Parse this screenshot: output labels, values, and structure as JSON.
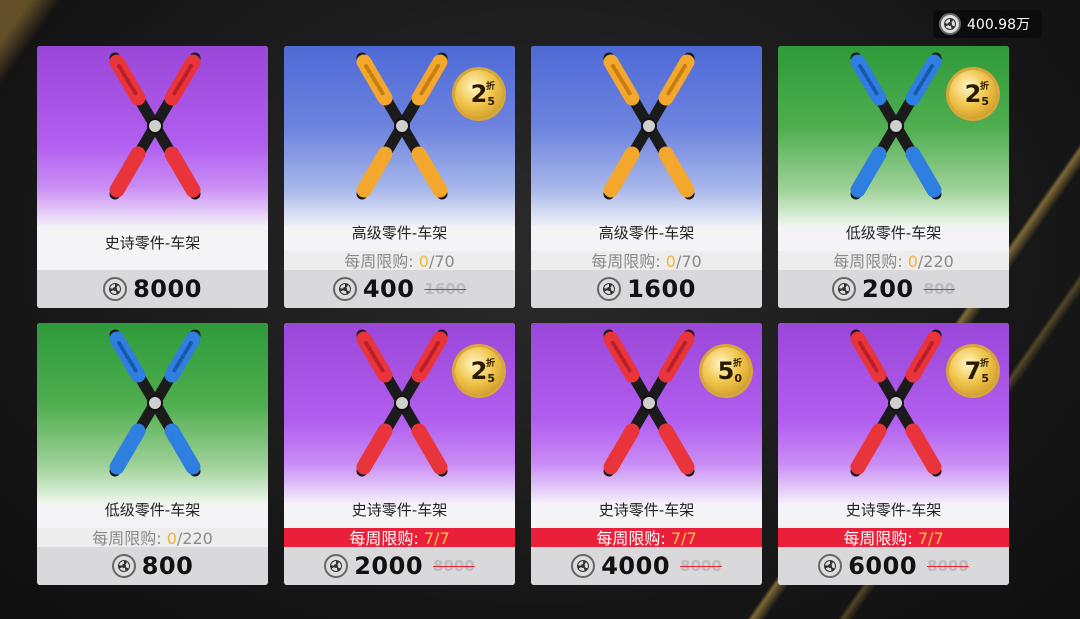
{
  "currency": {
    "icon": "coin-icon",
    "amount": "400.98万"
  },
  "colors": {
    "purple": "#b25ff0",
    "blue": "#6d83de",
    "green": "#4fae4f",
    "red_limit": "#ea1f3a",
    "gold": "#f0c44a"
  },
  "cards": [
    {
      "name": "史诗零件-车架",
      "bg": "purple",
      "grip": "red",
      "limit": null,
      "price": "8000",
      "old_price": null,
      "discount": null
    },
    {
      "name": "高级零件-车架",
      "bg": "blue",
      "grip": "orange",
      "limit": {
        "label": "每周限购:",
        "used": "0",
        "total": "/70",
        "hot": false
      },
      "price": "400",
      "old_price": "1600",
      "discount": {
        "big": "2",
        "small": "折",
        "dec": "5"
      }
    },
    {
      "name": "高级零件-车架",
      "bg": "blue",
      "grip": "orange",
      "limit": {
        "label": "每周限购:",
        "used": "0",
        "total": "/70",
        "hot": false
      },
      "price": "1600",
      "old_price": null,
      "discount": null
    },
    {
      "name": "低级零件-车架",
      "bg": "green",
      "grip": "blue",
      "limit": {
        "label": "每周限购:",
        "used": "0",
        "total": "/220",
        "hot": false
      },
      "price": "200",
      "old_price": "800",
      "discount": {
        "big": "2",
        "small": "折",
        "dec": "5"
      }
    },
    {
      "name": "低级零件-车架",
      "bg": "green",
      "grip": "blue",
      "limit": {
        "label": "每周限购:",
        "used": "0",
        "total": "/220",
        "hot": false
      },
      "price": "800",
      "old_price": null,
      "discount": null
    },
    {
      "name": "史诗零件-车架",
      "bg": "purple",
      "grip": "red",
      "limit": {
        "label": "每周限购:",
        "used": "7",
        "total": "/7",
        "hot": true
      },
      "price": "2000",
      "old_price": "8000",
      "discount": {
        "big": "2",
        "small": "折",
        "dec": "5"
      }
    },
    {
      "name": "史诗零件-车架",
      "bg": "purple",
      "grip": "red",
      "limit": {
        "label": "每周限购:",
        "used": "7",
        "total": "/7",
        "hot": true
      },
      "price": "4000",
      "old_price": "8000",
      "discount": {
        "big": "5",
        "small": "折",
        "dec": "0"
      }
    },
    {
      "name": "史诗零件-车架",
      "bg": "purple",
      "grip": "red",
      "limit": {
        "label": "每周限购:",
        "used": "7",
        "total": "/7",
        "hot": true
      },
      "price": "6000",
      "old_price": "8000",
      "discount": {
        "big": "7",
        "small": "折",
        "dec": "5"
      }
    }
  ]
}
